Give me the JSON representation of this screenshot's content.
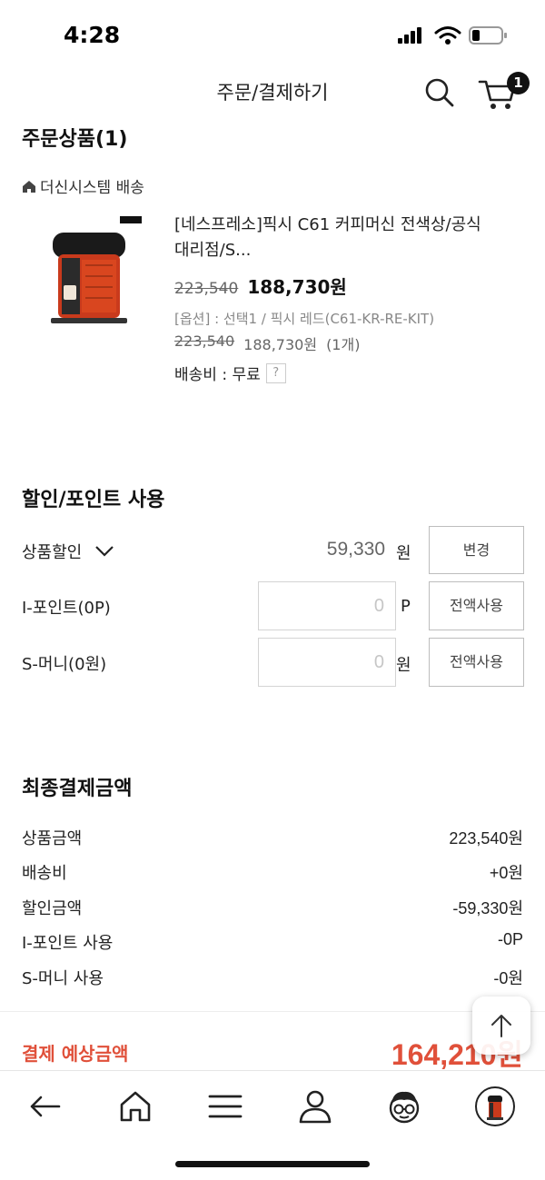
{
  "status": {
    "time": "4:28"
  },
  "header": {
    "title": "주문/결제하기",
    "cart_count": "1"
  },
  "order": {
    "section_title": "주문상품(1)",
    "shipping_group": "더신시스템 배송",
    "product": {
      "name_line1": "[네스프레소]픽시 C61 커피머신 전색상/공식",
      "name_line2": "대리점/S...",
      "original_price": "223,540",
      "sale_price": "188,730원",
      "option_text": "[옵션] : 선택1 / 픽시 레드(C61-KR-RE-KIT)",
      "option_original_price": "223,540",
      "option_sale_price": "188,730원",
      "option_qty": "(1개)",
      "shipping_fee_label": "배송비 : 무료",
      "help_icon": "?"
    }
  },
  "discount": {
    "section_title": "할인/포인트 사용",
    "product_discount_label": "상품할인",
    "product_discount_value": "59,330",
    "product_discount_unit": "원",
    "change_button": "변경",
    "ipoint_label": "I-포인트(0P)",
    "ipoint_value": "0",
    "ipoint_unit": "P",
    "ipoint_button": "전액사용",
    "smoney_label": "S-머니(0원)",
    "smoney_value": "0",
    "smoney_unit": "원",
    "smoney_button": "전액사용"
  },
  "summary": {
    "section_title": "최종결제금액",
    "rows": [
      {
        "label": "상품금액",
        "value": "223,540원"
      },
      {
        "label": "배송비",
        "value": "+0원"
      },
      {
        "label": "할인금액",
        "value": "-59,330원"
      },
      {
        "label": "I-포인트 사용",
        "value": "-0P"
      },
      {
        "label": "S-머니 사용",
        "value": "-0원"
      }
    ],
    "total_label": "결제 예상금액",
    "total_value": "164,210원"
  },
  "colors": {
    "accent": "#e0503a",
    "badge": "#111111"
  },
  "nav": {
    "icons": [
      "back-arrow-icon",
      "home-icon",
      "menu-icon",
      "user-icon",
      "mascot-icon",
      "product-thumb-icon"
    ]
  }
}
